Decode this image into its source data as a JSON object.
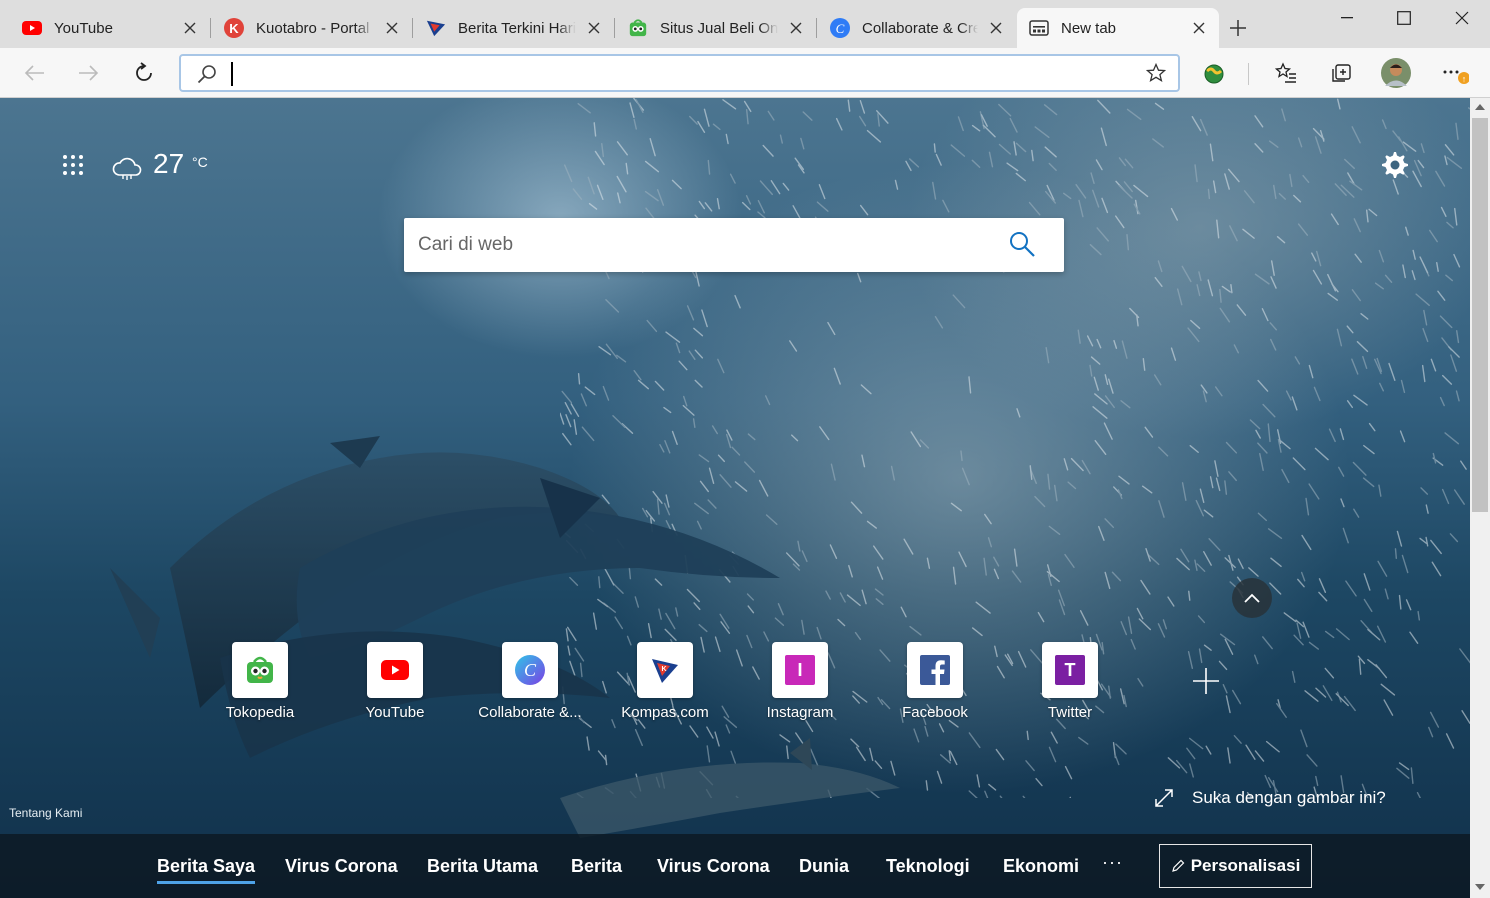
{
  "tabs": [
    {
      "title": "YouTube",
      "icon": "youtube-icon"
    },
    {
      "title": "Kuotabro - Portal",
      "icon": "kuotabro-icon"
    },
    {
      "title": "Berita Terkini Hari",
      "icon": "kompas-icon"
    },
    {
      "title": "Situs Jual Beli Onl",
      "icon": "tokopedia-icon"
    },
    {
      "title": "Collaborate & Cre",
      "icon": "canva-icon"
    },
    {
      "title": "New tab",
      "icon": "newtab-page-icon"
    }
  ],
  "address_bar": {
    "value": "",
    "placeholder": ""
  },
  "weather": {
    "temperature": "27",
    "unit": "°C"
  },
  "search": {
    "placeholder": "Cari di web"
  },
  "quick_links": [
    {
      "label": "Tokopedia",
      "icon": "tokopedia-icon"
    },
    {
      "label": "YouTube",
      "icon": "youtube-icon"
    },
    {
      "label": "Collaborate &...",
      "icon": "canva-icon"
    },
    {
      "label": "Kompas.com",
      "icon": "kompas-icon"
    },
    {
      "label": "Instagram",
      "icon": "instagram-letter-icon",
      "letter": "I"
    },
    {
      "label": "Facebook",
      "icon": "facebook-icon"
    },
    {
      "label": "Twitter",
      "icon": "twitter-letter-icon",
      "letter": "T"
    }
  ],
  "footer": {
    "about": "Tentang Kami",
    "like_image": "Suka dengan gambar ini?"
  },
  "news_nav": {
    "items": [
      "Berita Saya",
      "Virus Corona",
      "Berita Utama",
      "Berita",
      "Virus Corona",
      "Dunia",
      "Teknologi",
      "Ekonomi"
    ],
    "more": "···",
    "personalize": "Personalisasi"
  },
  "colors": {
    "accent": "#4ea3e8",
    "youtube_red": "#ff0000",
    "instagram_tile": "#c828b8",
    "twitter_tile": "#7b1fa2",
    "facebook_blue": "#3b5998",
    "canva_blue": "#2f7cf6",
    "tokopedia_green": "#42b549"
  }
}
